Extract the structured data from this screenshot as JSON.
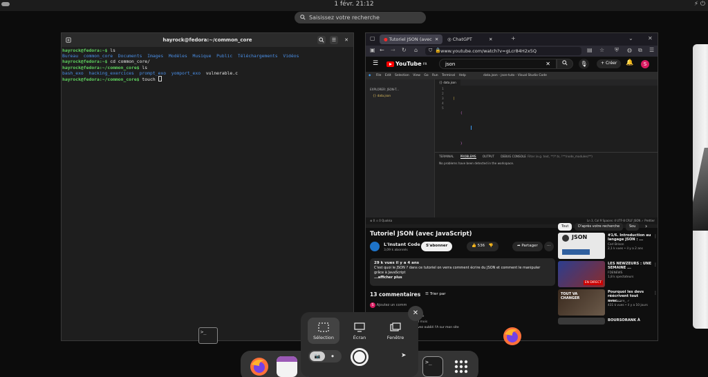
{
  "topbar": {
    "clock": "1 févr.  21:12",
    "system_icons": "⚡ ⏻"
  },
  "overview": {
    "search_placeholder": "Saisissez votre recherche"
  },
  "terminal": {
    "title": "hayrock@fedora:~/common_core",
    "prompt_home": "hayrock@fedora:~$",
    "prompt_core": "hayrock@fedora:~/common_core$",
    "cmd_ls": " ls",
    "cmd_cd": " cd common_core/",
    "cmd_touch": " touch ",
    "home_listing": "Bureau  common_core  Documents  Images  Modèles  Musique  Public  Téléchargements  Vidéos",
    "core_dirs": "bash_exo  hacking_exercices  prompt_exo  yomport_exo",
    "core_file": "vulnerable.c"
  },
  "browser": {
    "tabs": [
      {
        "label": "Tutoriel JSON (avec"
      },
      {
        "label": "ChatGPT"
      }
    ],
    "new_tab": "+",
    "url": "www.youtube.com/watch?v=gLcr84H2x5Q"
  },
  "youtube": {
    "logo": "YouTube",
    "logo_region": "FR",
    "search_value": "json",
    "create_label": "Créer",
    "avatar_letter": "S",
    "video": {
      "vscode_title": "data.json - json-tuto - Visual Studio Code",
      "vscode_menu": [
        "File",
        "Edit",
        "Selection",
        "View",
        "Go",
        "Run",
        "Terminal",
        "Help"
      ],
      "explorer_label": "EXPLORER: JSON-T...",
      "explorer_file": "data.json",
      "editor_tab": "data.json",
      "code_lines": [
        "[",
        "    {",
        "",
        "    }",
        "]"
      ],
      "line_numbers": [
        "1",
        "2",
        "3",
        "4",
        "5"
      ],
      "panel_tabs": [
        "TERMINAL",
        "PROBLEMS",
        "OUTPUT",
        "DEBUG CONSOLE"
      ],
      "panel_filter": "Filter (e.g. text, **/*.ts, !**/node_modules/**)",
      "panel_message": "No problems have been detected in the workspace.",
      "status_left": "⊗ 0 ⚠ 0    Quokka",
      "status_right": "Ln 3, Col 9   Spaces: 4   UTF-8   CRLF   JSON   ✓ Prettier"
    },
    "title": "Tutoriel JSON (avec JavaScript)",
    "channel": {
      "name": "L'Instant Code",
      "subs": "3,09 k abonnés",
      "subscribe": "S'abonner"
    },
    "likes": "536",
    "share": "Partager",
    "description": {
      "meta": "29 k vues  il y a 4 ans",
      "text": "C'est quoi le JSON ? dans ce tutoriel on verra comment écrire du JSON et comment le manipuler grâce à JavaScript",
      "more": "...afficher plus"
    },
    "comments_count": "13 commentaires",
    "sort_label": "Trier par",
    "add_comment": "Ajoutez un comm",
    "comment_snippet_1": "nCode",
    "comment_snippet_2": "a 8 mois",
    "comment_snippet_3": "i'avez oublié l'A sur mon site",
    "chips": [
      "Tout",
      "D'après votre recherche",
      "Sou"
    ],
    "recommendations": [
      {
        "title": "#1/6. Introduction au langage JSON : ...",
        "channel": "Carl Brison",
        "meta": "2,1 k vues • il y a 2 ans",
        "thumb_text": "JSON"
      },
      {
        "title": "LES NEWZEURS : UNE SEMAINE ...",
        "channel": "FDENEWS",
        "meta": "1,8 k spectateurs",
        "thumb_text": "EN DIRECT"
      },
      {
        "title": "Pourquoi les devs réécrivent tout avec...",
        "channel": "Underscore_ ✓",
        "meta": "431 k vues • il y a 10 jours",
        "thumb_text": "TOUT VA CHANGER"
      },
      {
        "title": "BOURSORANK À",
        "channel": "",
        "meta": "",
        "thumb_text": ""
      }
    ]
  },
  "screenshot": {
    "options": [
      "Sélection",
      "Écran",
      "Fenêtre"
    ],
    "close": "✕"
  }
}
